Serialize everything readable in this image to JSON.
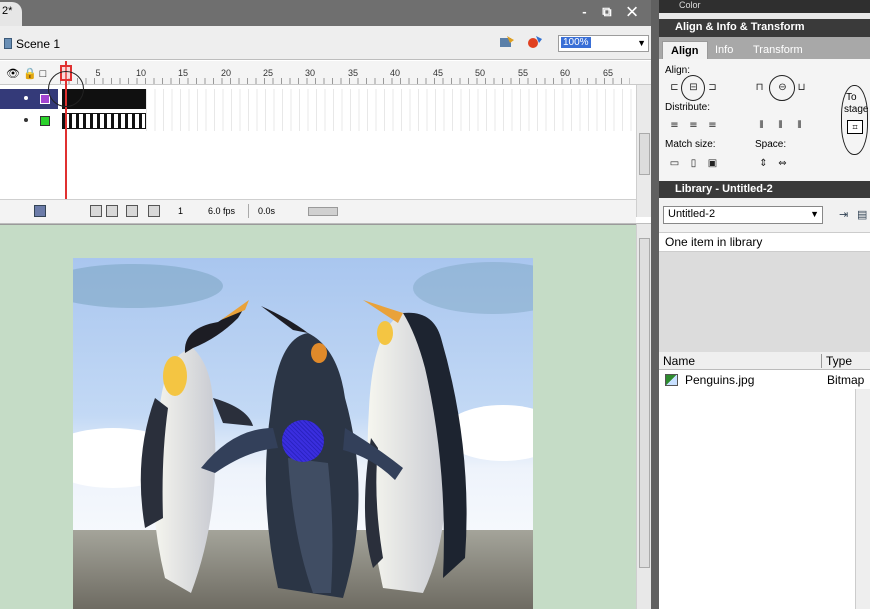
{
  "doc_tab": {
    "title": "2*"
  },
  "window_controls": "- ⧉ ✕",
  "scene": {
    "label": "Scene 1",
    "zoom": "100%"
  },
  "timeline": {
    "ruler_labels": [
      "5",
      "10",
      "15",
      "20",
      "25",
      "30",
      "35",
      "40",
      "45",
      "50",
      "55",
      "60",
      "65"
    ],
    "layer_header_icons": "👁🔒□",
    "status": {
      "frame": "1",
      "fps": "6.0 fps",
      "time": "0.0s"
    }
  },
  "colors": {
    "stage_bg": "#c5dcc6",
    "panel_header": "#3a3a3a",
    "layer_selected": "#343a79",
    "playhead": "#e03030",
    "hit_circle": "#3b2ee6"
  },
  "panels": {
    "color_header": "Color",
    "align_header": "Align & Info & Transform",
    "tabs": [
      "Align",
      "Info",
      "Transform"
    ],
    "align": {
      "align_label": "Align:",
      "distribute_label": "Distribute:",
      "match_size_label": "Match size:",
      "space_label": "Space:",
      "to_stage_line1": "To",
      "to_stage_line2": "stage"
    },
    "library": {
      "header": "Library - Untitled-2",
      "selected": "Untitled-2",
      "count_text": "One item in library",
      "col_name": "Name",
      "col_type": "Type",
      "items": [
        {
          "name": "Penguins.jpg",
          "type": "Bitmap"
        }
      ]
    }
  }
}
